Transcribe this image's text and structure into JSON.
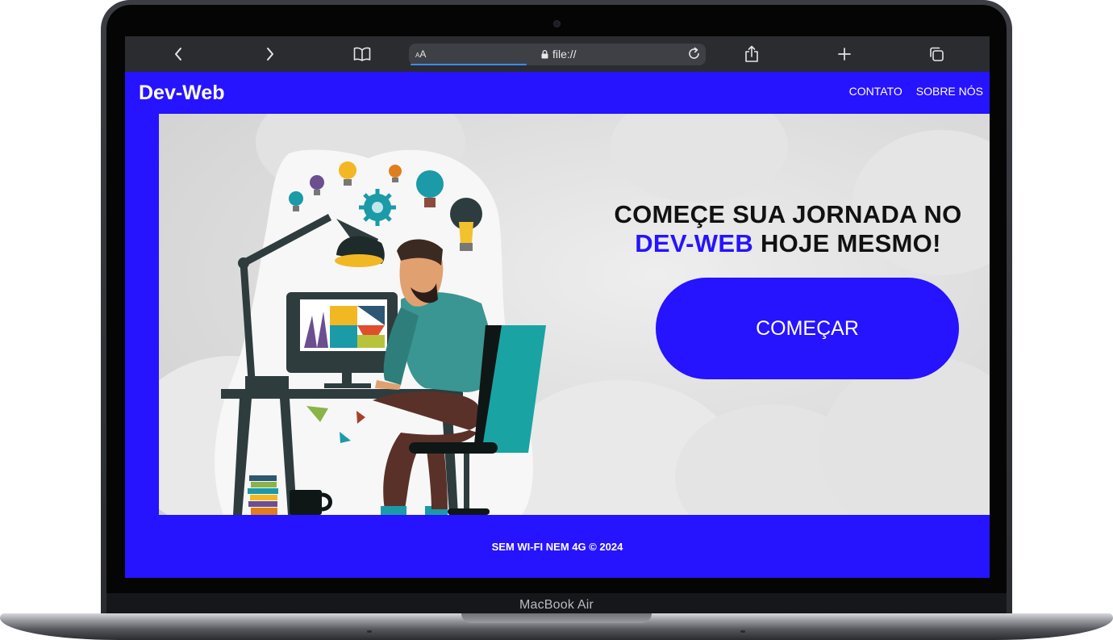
{
  "device": {
    "label": "MacBook Air"
  },
  "browser": {
    "text_size_label_small": "A",
    "text_size_label_large": "A",
    "url": "file://",
    "icons": [
      "chevron-left-icon",
      "chevron-right-icon",
      "book-icon",
      "lock-icon",
      "reload-icon",
      "share-icon",
      "plus-icon",
      "tabs-icon"
    ],
    "progress_fraction": 0.39
  },
  "site": {
    "logo": "Dev-Web",
    "nav": {
      "contato": "CONTATO",
      "sobre": "SOBRE NÓS"
    },
    "hero": {
      "headline_line1": "COMEÇE SUA JORNADA NO",
      "headline_accent": "DEV-WEB",
      "headline_rest": "HOJE MESMO!",
      "cta_label": "COMEÇAR"
    },
    "footer_text": "SEM WI-FI NEM 4G © 2024"
  },
  "colors": {
    "brand_blue": "#2613ff",
    "browser_bar": "#2a2c30",
    "headline_text": "#111111"
  }
}
